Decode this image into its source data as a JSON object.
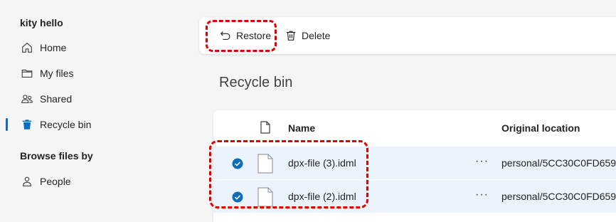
{
  "sidebar": {
    "user_name": "kity hello",
    "items": [
      {
        "label": "Home",
        "icon": "home-icon"
      },
      {
        "label": "My files",
        "icon": "folder-icon"
      },
      {
        "label": "Shared",
        "icon": "people-icon"
      },
      {
        "label": "Recycle bin",
        "icon": "trash-icon",
        "active": true
      }
    ],
    "browse_title": "Browse files by",
    "browse_items": [
      {
        "label": "People",
        "icon": "person-icon"
      }
    ]
  },
  "toolbar": {
    "restore_label": "Restore",
    "delete_label": "Delete"
  },
  "page": {
    "title": "Recycle bin"
  },
  "table": {
    "columns": [
      "Name",
      "Original location"
    ],
    "rows": [
      {
        "name": "dpx-file (3).idml",
        "location": "personal/5CC30C0FD6599",
        "selected": true
      },
      {
        "name": "dpx-file (2).idml",
        "location": "personal/5CC30C0FD6599",
        "selected": true
      }
    ]
  },
  "colors": {
    "accent": "#0f6cbd",
    "selected_row": "#ebf3fc",
    "annotation": "#e00000"
  }
}
